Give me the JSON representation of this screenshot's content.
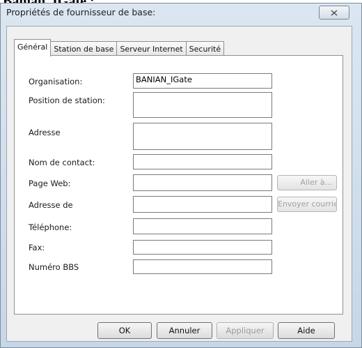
{
  "document": {
    "heading": "Banian_IGate :"
  },
  "window": {
    "title": "Propriétés de fournisseur de base:",
    "close_icon": "close-x-icon"
  },
  "tabs": [
    {
      "label": "Général",
      "active": true
    },
    {
      "label": "Station de base",
      "active": false
    },
    {
      "label": "Serveur Internet",
      "active": false
    },
    {
      "label": "Securité",
      "active": false
    }
  ],
  "form": {
    "organisation": {
      "label": "Organisation:",
      "value": "BANIAN_IGate"
    },
    "position": {
      "label": "Position de station:",
      "value": ""
    },
    "adresse": {
      "label": "Adresse",
      "value": ""
    },
    "contact": {
      "label": "Nom de contact:",
      "value": ""
    },
    "web": {
      "label": "Page Web:",
      "value": ""
    },
    "email": {
      "label": "Adresse de",
      "value": ""
    },
    "phone": {
      "label": "Téléphone:",
      "value": ""
    },
    "fax": {
      "label": "Fax:",
      "value": ""
    },
    "bbs": {
      "label": "Numéro BBS",
      "value": ""
    }
  },
  "side_buttons": {
    "goto": "Aller à...",
    "send_mail": "Envoyer courriel"
  },
  "buttons": {
    "ok": "OK",
    "cancel": "Annuler",
    "apply": "Appliquer",
    "help": "Aide"
  },
  "colors": {
    "frame": "#c7d7e8",
    "client": "#f0f0f0",
    "disabled_text": "#9a9a9a"
  }
}
